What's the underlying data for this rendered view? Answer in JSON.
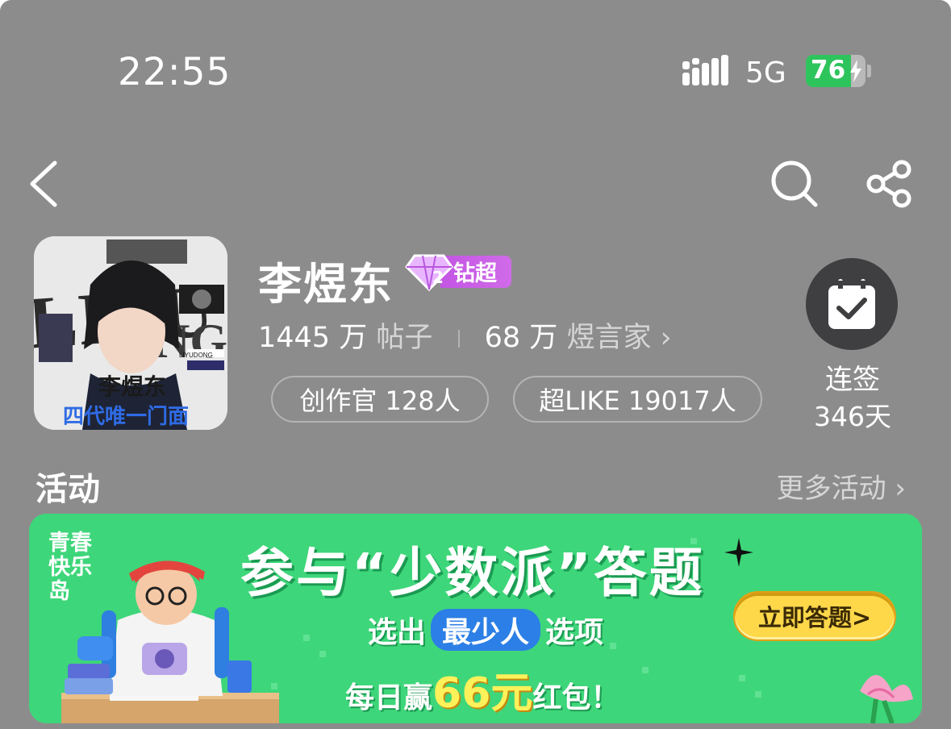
{
  "status_bar": {
    "time": "22:55",
    "network": "5G",
    "battery_level": "76",
    "battery_fraction": 0.76,
    "battery_charging": true,
    "colors": {
      "battery_fill": "#2ec45c"
    }
  },
  "nav": {
    "back_icon": "chevron-left-icon",
    "search_icon": "search-icon",
    "share_icon": "share-icon"
  },
  "topic": {
    "avatar_text": "李煜东",
    "avatar_subtitle": "四代唯一门面",
    "avatar_name_latin": "LIYUDONG",
    "title": "李煜东",
    "level_badge": "钻超",
    "posts_count": "1445 万",
    "posts_label": "帖子",
    "fans_count": "68 万",
    "fans_label": "煜言家",
    "fans_chevron": "›",
    "creator_pill": "创作官 128人",
    "superlike_pill": "超LIKE 19017人",
    "checkin_label": "连签",
    "checkin_days": "346天",
    "colors": {
      "level_badge": "#c355e4"
    }
  },
  "activity": {
    "title": "活动",
    "more_link": "更多活动 ›",
    "banner": {
      "brand": "青春快乐岛",
      "headline": "参与“少数派”答题",
      "line1_prefix": "选出",
      "line1_highlight": "最少人",
      "line1_suffix": "选项",
      "line2_prefix": "每日赢",
      "line2_amount": "66元",
      "line2_suffix": "红包！",
      "cta": "立即答题>",
      "colors": {
        "background": "#3ed67a",
        "cta": "#ffd84a"
      }
    }
  }
}
